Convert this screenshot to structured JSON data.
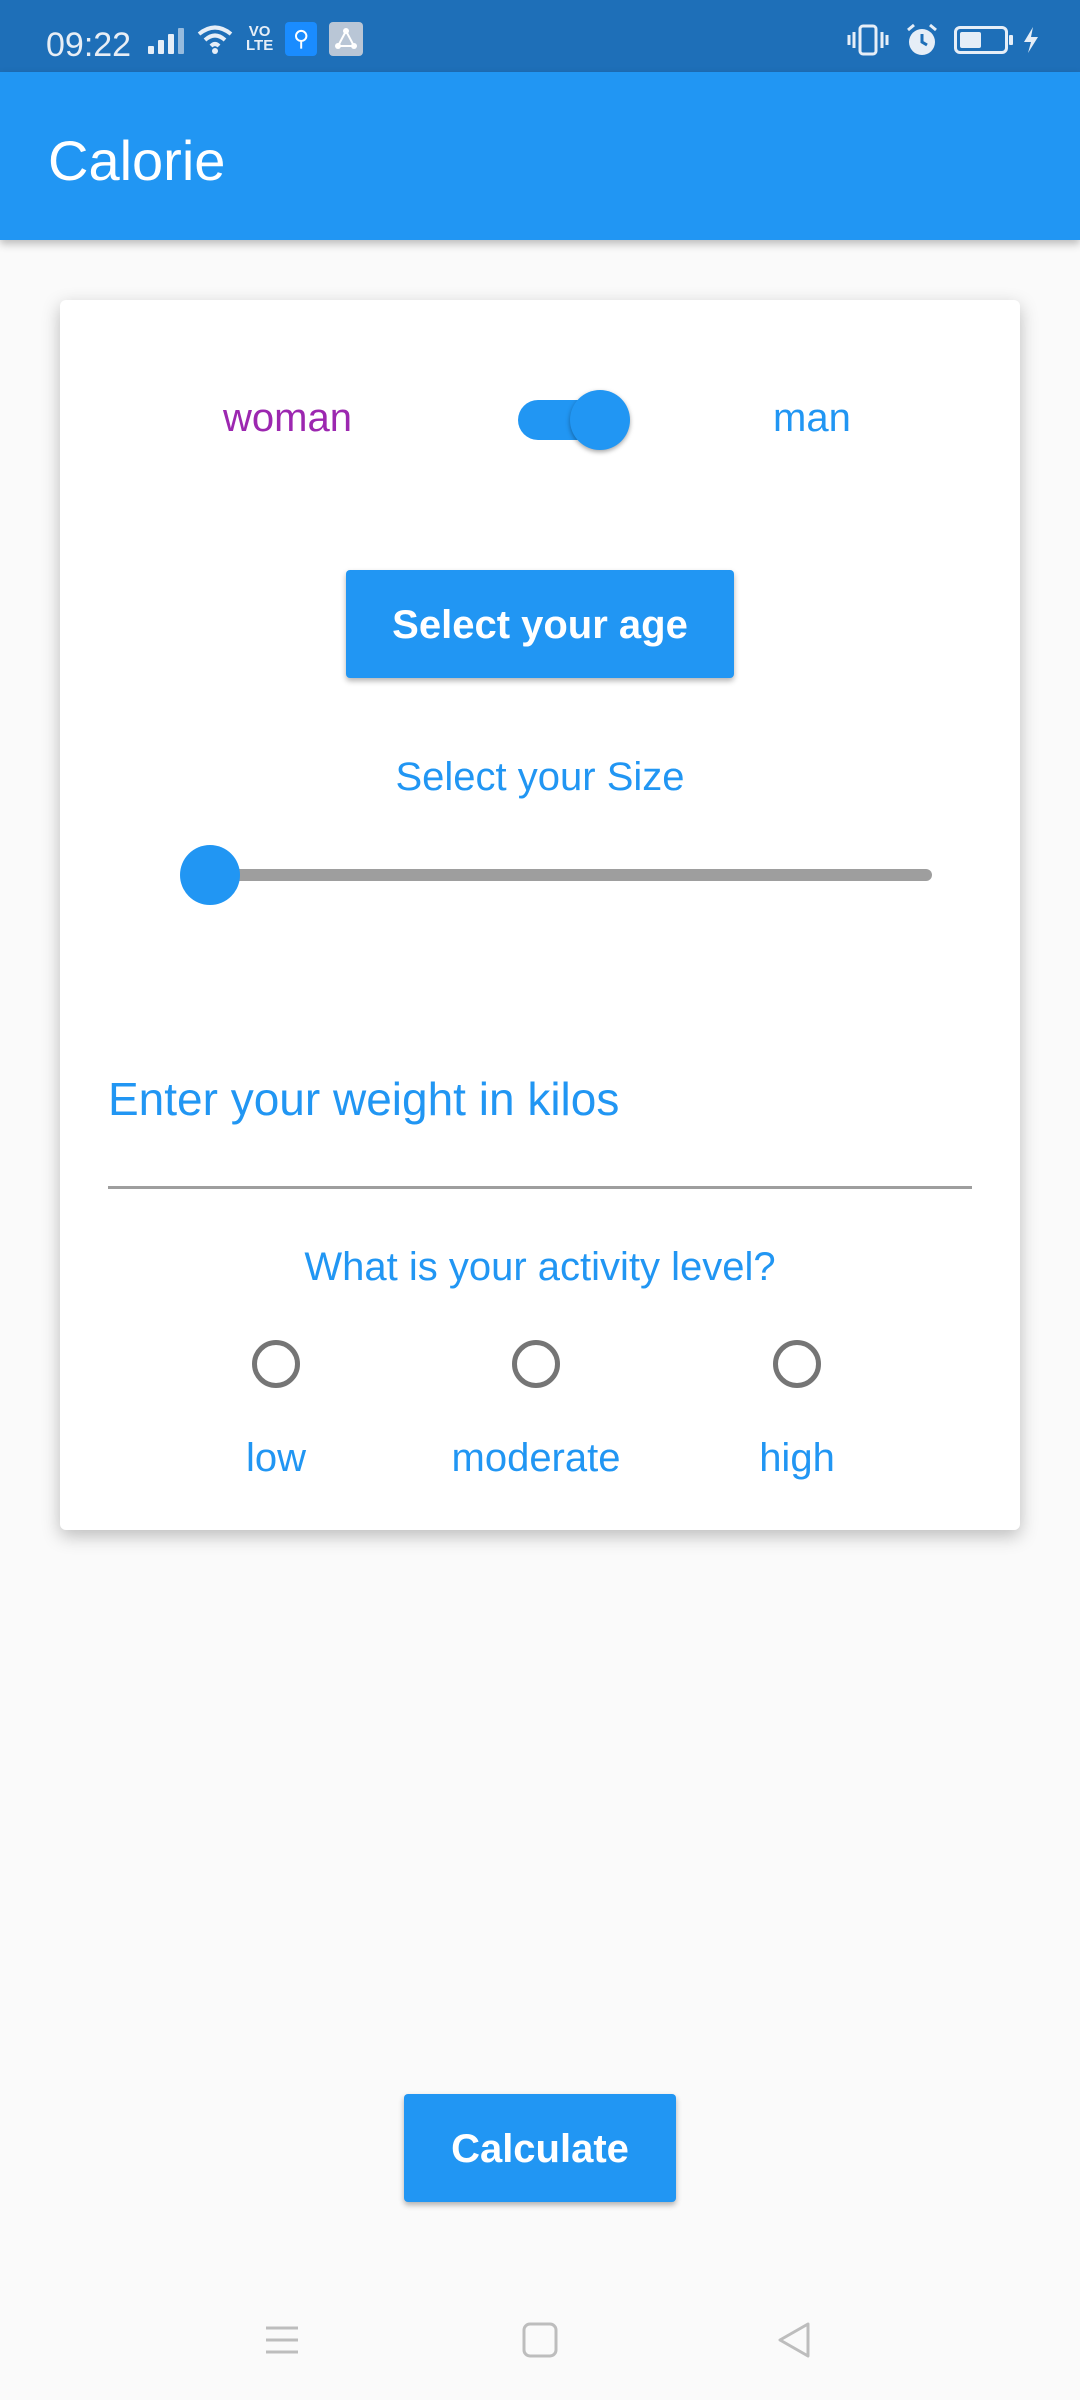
{
  "status_bar": {
    "time": "09:22",
    "volte": "VO\nLTE",
    "icons": [
      "signal-icon",
      "wifi-icon",
      "volte-icon",
      "usb-icon",
      "notification-icon",
      "vibrate-icon",
      "alarm-icon",
      "battery-icon",
      "charging-icon"
    ],
    "battery_level": 0.44
  },
  "app_bar": {
    "title": "Calorie"
  },
  "form": {
    "gender": {
      "left_label": "woman",
      "right_label": "man",
      "switch_on": true
    },
    "age_button": "Select your age",
    "size_label": "Select your Size",
    "size_slider_value": 0,
    "weight_placeholder": "Enter your weight in kilos",
    "activity_question": "What is your activity level?",
    "activity_options": [
      "low",
      "moderate",
      "high"
    ]
  },
  "calculate_button": "Calculate",
  "colors": {
    "primary": "#2196F3",
    "status_bar": "#1E6FB8",
    "woman_label": "#9C27B0",
    "slider_rail": "#9E9E9E"
  },
  "navigation": {
    "icons": [
      "menu-icon",
      "home-icon",
      "back-icon"
    ]
  }
}
